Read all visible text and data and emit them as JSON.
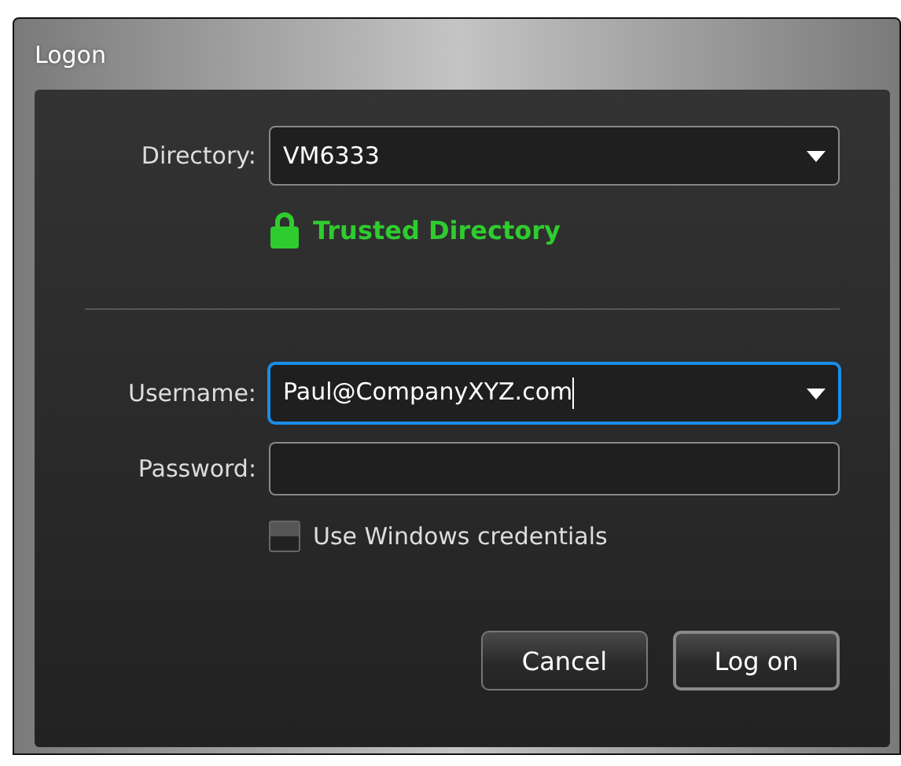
{
  "window": {
    "title": "Logon"
  },
  "directory": {
    "label": "Directory:",
    "value": "VM6333",
    "kind": "dropdown",
    "focused": false
  },
  "trust": {
    "text": "Trusted Directory"
  },
  "credentials": [
    {
      "label": "Username:",
      "value": "Paul@CompanyXYZ.com",
      "kind": "dropdown",
      "focused": true
    },
    {
      "label": "Password:",
      "kind": "password",
      "focused": false
    }
  ],
  "windows_credentials": {
    "label": "Use Windows credentials",
    "checked": false
  },
  "buttons": [
    {
      "label": "Cancel",
      "default": false
    },
    {
      "label": "Log on",
      "default": true
    }
  ]
}
